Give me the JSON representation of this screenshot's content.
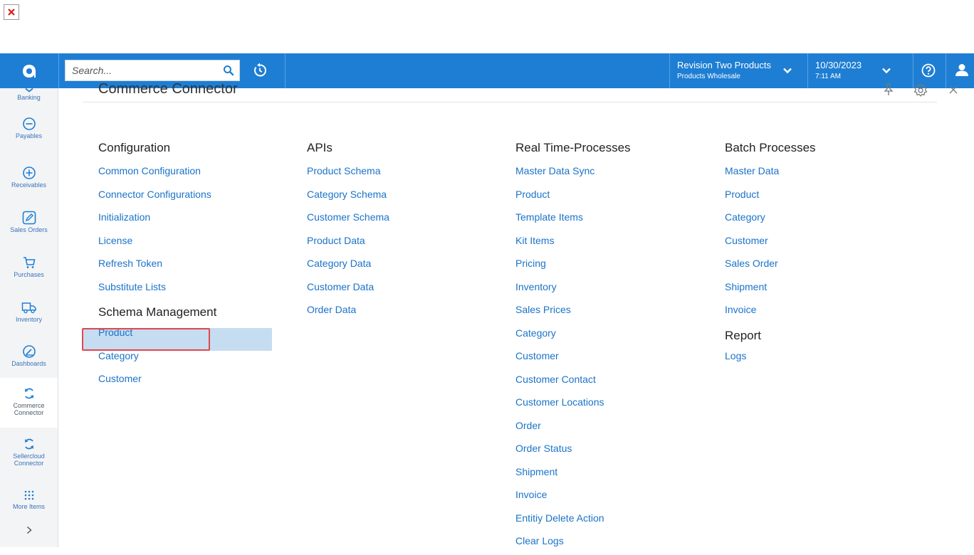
{
  "search": {
    "placeholder": "Search..."
  },
  "branch": {
    "name": "Revision Two Products",
    "sub": "Products Wholesale"
  },
  "datetime": {
    "date": "10/30/2023",
    "time": "7:11 AM"
  },
  "sidebar": {
    "items": [
      {
        "label": "Banking",
        "icon": "bank-icon"
      },
      {
        "label": "Payables",
        "icon": "minus-circle-icon"
      },
      {
        "label": "Receivables",
        "icon": "plus-circle-icon"
      },
      {
        "label": "Sales Orders",
        "icon": "pencil-icon"
      },
      {
        "label": "Purchases",
        "icon": "cart-icon"
      },
      {
        "label": "Inventory",
        "icon": "truck-icon"
      },
      {
        "label": "Dashboards",
        "icon": "gauge-icon"
      },
      {
        "label": "Commerce Connector",
        "icon": "sync-icon",
        "active": true
      },
      {
        "label": "Sellercloud Connector",
        "icon": "sync-icon"
      },
      {
        "label": "More Items",
        "icon": "grid-icon"
      }
    ]
  },
  "panel": {
    "title": "Commerce Connector",
    "columns": [
      {
        "heading": "Configuration",
        "links": [
          "Common Configuration",
          "Connector Configurations",
          "Initialization",
          "License",
          "Refresh Token",
          "Substitute Lists"
        ],
        "subheading": "Schema Management",
        "sublinks": [
          "Product",
          "Category",
          "Customer"
        ]
      },
      {
        "heading": "APIs",
        "links": [
          "Product Schema",
          "Category Schema",
          "Customer Schema",
          "Product Data",
          "Category Data",
          "Customer Data",
          "Order Data"
        ]
      },
      {
        "heading": "Real Time-Processes",
        "links": [
          "Master Data Sync",
          "Product",
          "Template Items",
          "Kit Items",
          "Pricing",
          "Inventory",
          "Sales Prices",
          "Category",
          "Customer",
          "Customer Contact",
          "Customer Locations",
          "Order",
          "Order Status",
          "Shipment",
          "Invoice",
          "Entitiy Delete Action",
          "Clear Logs"
        ]
      },
      {
        "heading": "Batch Processes",
        "links": [
          "Master Data",
          "Product",
          "Category",
          "Customer",
          "Sales Order",
          "Shipment",
          "Invoice"
        ],
        "subheading": "Report",
        "sublinks": [
          "Logs"
        ]
      }
    ]
  },
  "colors": {
    "accent": "#1e7ed3",
    "link": "#1a73c9",
    "selected": "#c6dcf0",
    "highlight_border": "#e0484f"
  }
}
